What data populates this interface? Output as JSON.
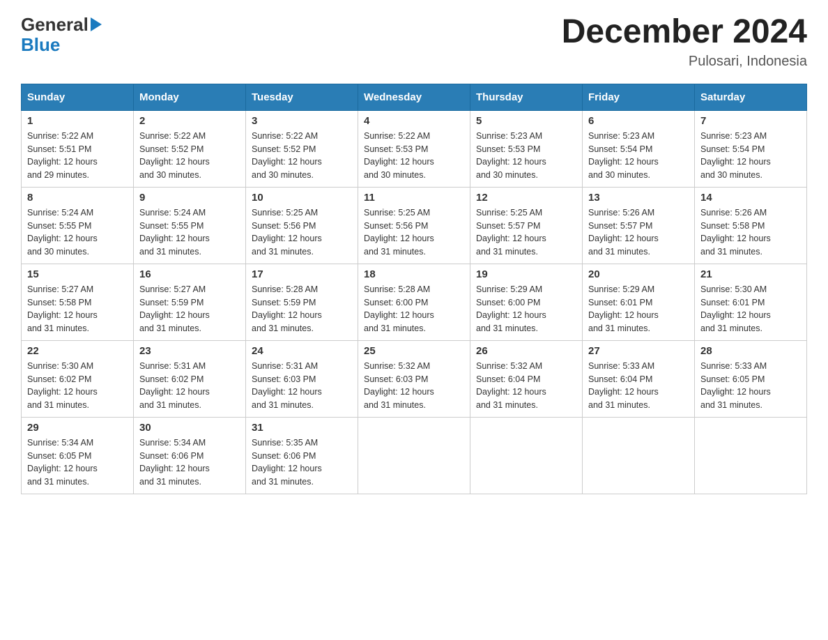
{
  "header": {
    "logo_general": "General",
    "logo_blue": "Blue",
    "month_title": "December 2024",
    "location": "Pulosari, Indonesia"
  },
  "weekdays": [
    "Sunday",
    "Monday",
    "Tuesday",
    "Wednesday",
    "Thursday",
    "Friday",
    "Saturday"
  ],
  "weeks": [
    [
      {
        "day": "1",
        "sunrise": "5:22 AM",
        "sunset": "5:51 PM",
        "daylight": "12 hours and 29 minutes."
      },
      {
        "day": "2",
        "sunrise": "5:22 AM",
        "sunset": "5:52 PM",
        "daylight": "12 hours and 30 minutes."
      },
      {
        "day": "3",
        "sunrise": "5:22 AM",
        "sunset": "5:52 PM",
        "daylight": "12 hours and 30 minutes."
      },
      {
        "day": "4",
        "sunrise": "5:22 AM",
        "sunset": "5:53 PM",
        "daylight": "12 hours and 30 minutes."
      },
      {
        "day": "5",
        "sunrise": "5:23 AM",
        "sunset": "5:53 PM",
        "daylight": "12 hours and 30 minutes."
      },
      {
        "day": "6",
        "sunrise": "5:23 AM",
        "sunset": "5:54 PM",
        "daylight": "12 hours and 30 minutes."
      },
      {
        "day": "7",
        "sunrise": "5:23 AM",
        "sunset": "5:54 PM",
        "daylight": "12 hours and 30 minutes."
      }
    ],
    [
      {
        "day": "8",
        "sunrise": "5:24 AM",
        "sunset": "5:55 PM",
        "daylight": "12 hours and 30 minutes."
      },
      {
        "day": "9",
        "sunrise": "5:24 AM",
        "sunset": "5:55 PM",
        "daylight": "12 hours and 31 minutes."
      },
      {
        "day": "10",
        "sunrise": "5:25 AM",
        "sunset": "5:56 PM",
        "daylight": "12 hours and 31 minutes."
      },
      {
        "day": "11",
        "sunrise": "5:25 AM",
        "sunset": "5:56 PM",
        "daylight": "12 hours and 31 minutes."
      },
      {
        "day": "12",
        "sunrise": "5:25 AM",
        "sunset": "5:57 PM",
        "daylight": "12 hours and 31 minutes."
      },
      {
        "day": "13",
        "sunrise": "5:26 AM",
        "sunset": "5:57 PM",
        "daylight": "12 hours and 31 minutes."
      },
      {
        "day": "14",
        "sunrise": "5:26 AM",
        "sunset": "5:58 PM",
        "daylight": "12 hours and 31 minutes."
      }
    ],
    [
      {
        "day": "15",
        "sunrise": "5:27 AM",
        "sunset": "5:58 PM",
        "daylight": "12 hours and 31 minutes."
      },
      {
        "day": "16",
        "sunrise": "5:27 AM",
        "sunset": "5:59 PM",
        "daylight": "12 hours and 31 minutes."
      },
      {
        "day": "17",
        "sunrise": "5:28 AM",
        "sunset": "5:59 PM",
        "daylight": "12 hours and 31 minutes."
      },
      {
        "day": "18",
        "sunrise": "5:28 AM",
        "sunset": "6:00 PM",
        "daylight": "12 hours and 31 minutes."
      },
      {
        "day": "19",
        "sunrise": "5:29 AM",
        "sunset": "6:00 PM",
        "daylight": "12 hours and 31 minutes."
      },
      {
        "day": "20",
        "sunrise": "5:29 AM",
        "sunset": "6:01 PM",
        "daylight": "12 hours and 31 minutes."
      },
      {
        "day": "21",
        "sunrise": "5:30 AM",
        "sunset": "6:01 PM",
        "daylight": "12 hours and 31 minutes."
      }
    ],
    [
      {
        "day": "22",
        "sunrise": "5:30 AM",
        "sunset": "6:02 PM",
        "daylight": "12 hours and 31 minutes."
      },
      {
        "day": "23",
        "sunrise": "5:31 AM",
        "sunset": "6:02 PM",
        "daylight": "12 hours and 31 minutes."
      },
      {
        "day": "24",
        "sunrise": "5:31 AM",
        "sunset": "6:03 PM",
        "daylight": "12 hours and 31 minutes."
      },
      {
        "day": "25",
        "sunrise": "5:32 AM",
        "sunset": "6:03 PM",
        "daylight": "12 hours and 31 minutes."
      },
      {
        "day": "26",
        "sunrise": "5:32 AM",
        "sunset": "6:04 PM",
        "daylight": "12 hours and 31 minutes."
      },
      {
        "day": "27",
        "sunrise": "5:33 AM",
        "sunset": "6:04 PM",
        "daylight": "12 hours and 31 minutes."
      },
      {
        "day": "28",
        "sunrise": "5:33 AM",
        "sunset": "6:05 PM",
        "daylight": "12 hours and 31 minutes."
      }
    ],
    [
      {
        "day": "29",
        "sunrise": "5:34 AM",
        "sunset": "6:05 PM",
        "daylight": "12 hours and 31 minutes."
      },
      {
        "day": "30",
        "sunrise": "5:34 AM",
        "sunset": "6:06 PM",
        "daylight": "12 hours and 31 minutes."
      },
      {
        "day": "31",
        "sunrise": "5:35 AM",
        "sunset": "6:06 PM",
        "daylight": "12 hours and 31 minutes."
      },
      null,
      null,
      null,
      null
    ]
  ],
  "labels": {
    "sunrise": "Sunrise:",
    "sunset": "Sunset:",
    "daylight": "Daylight:"
  }
}
